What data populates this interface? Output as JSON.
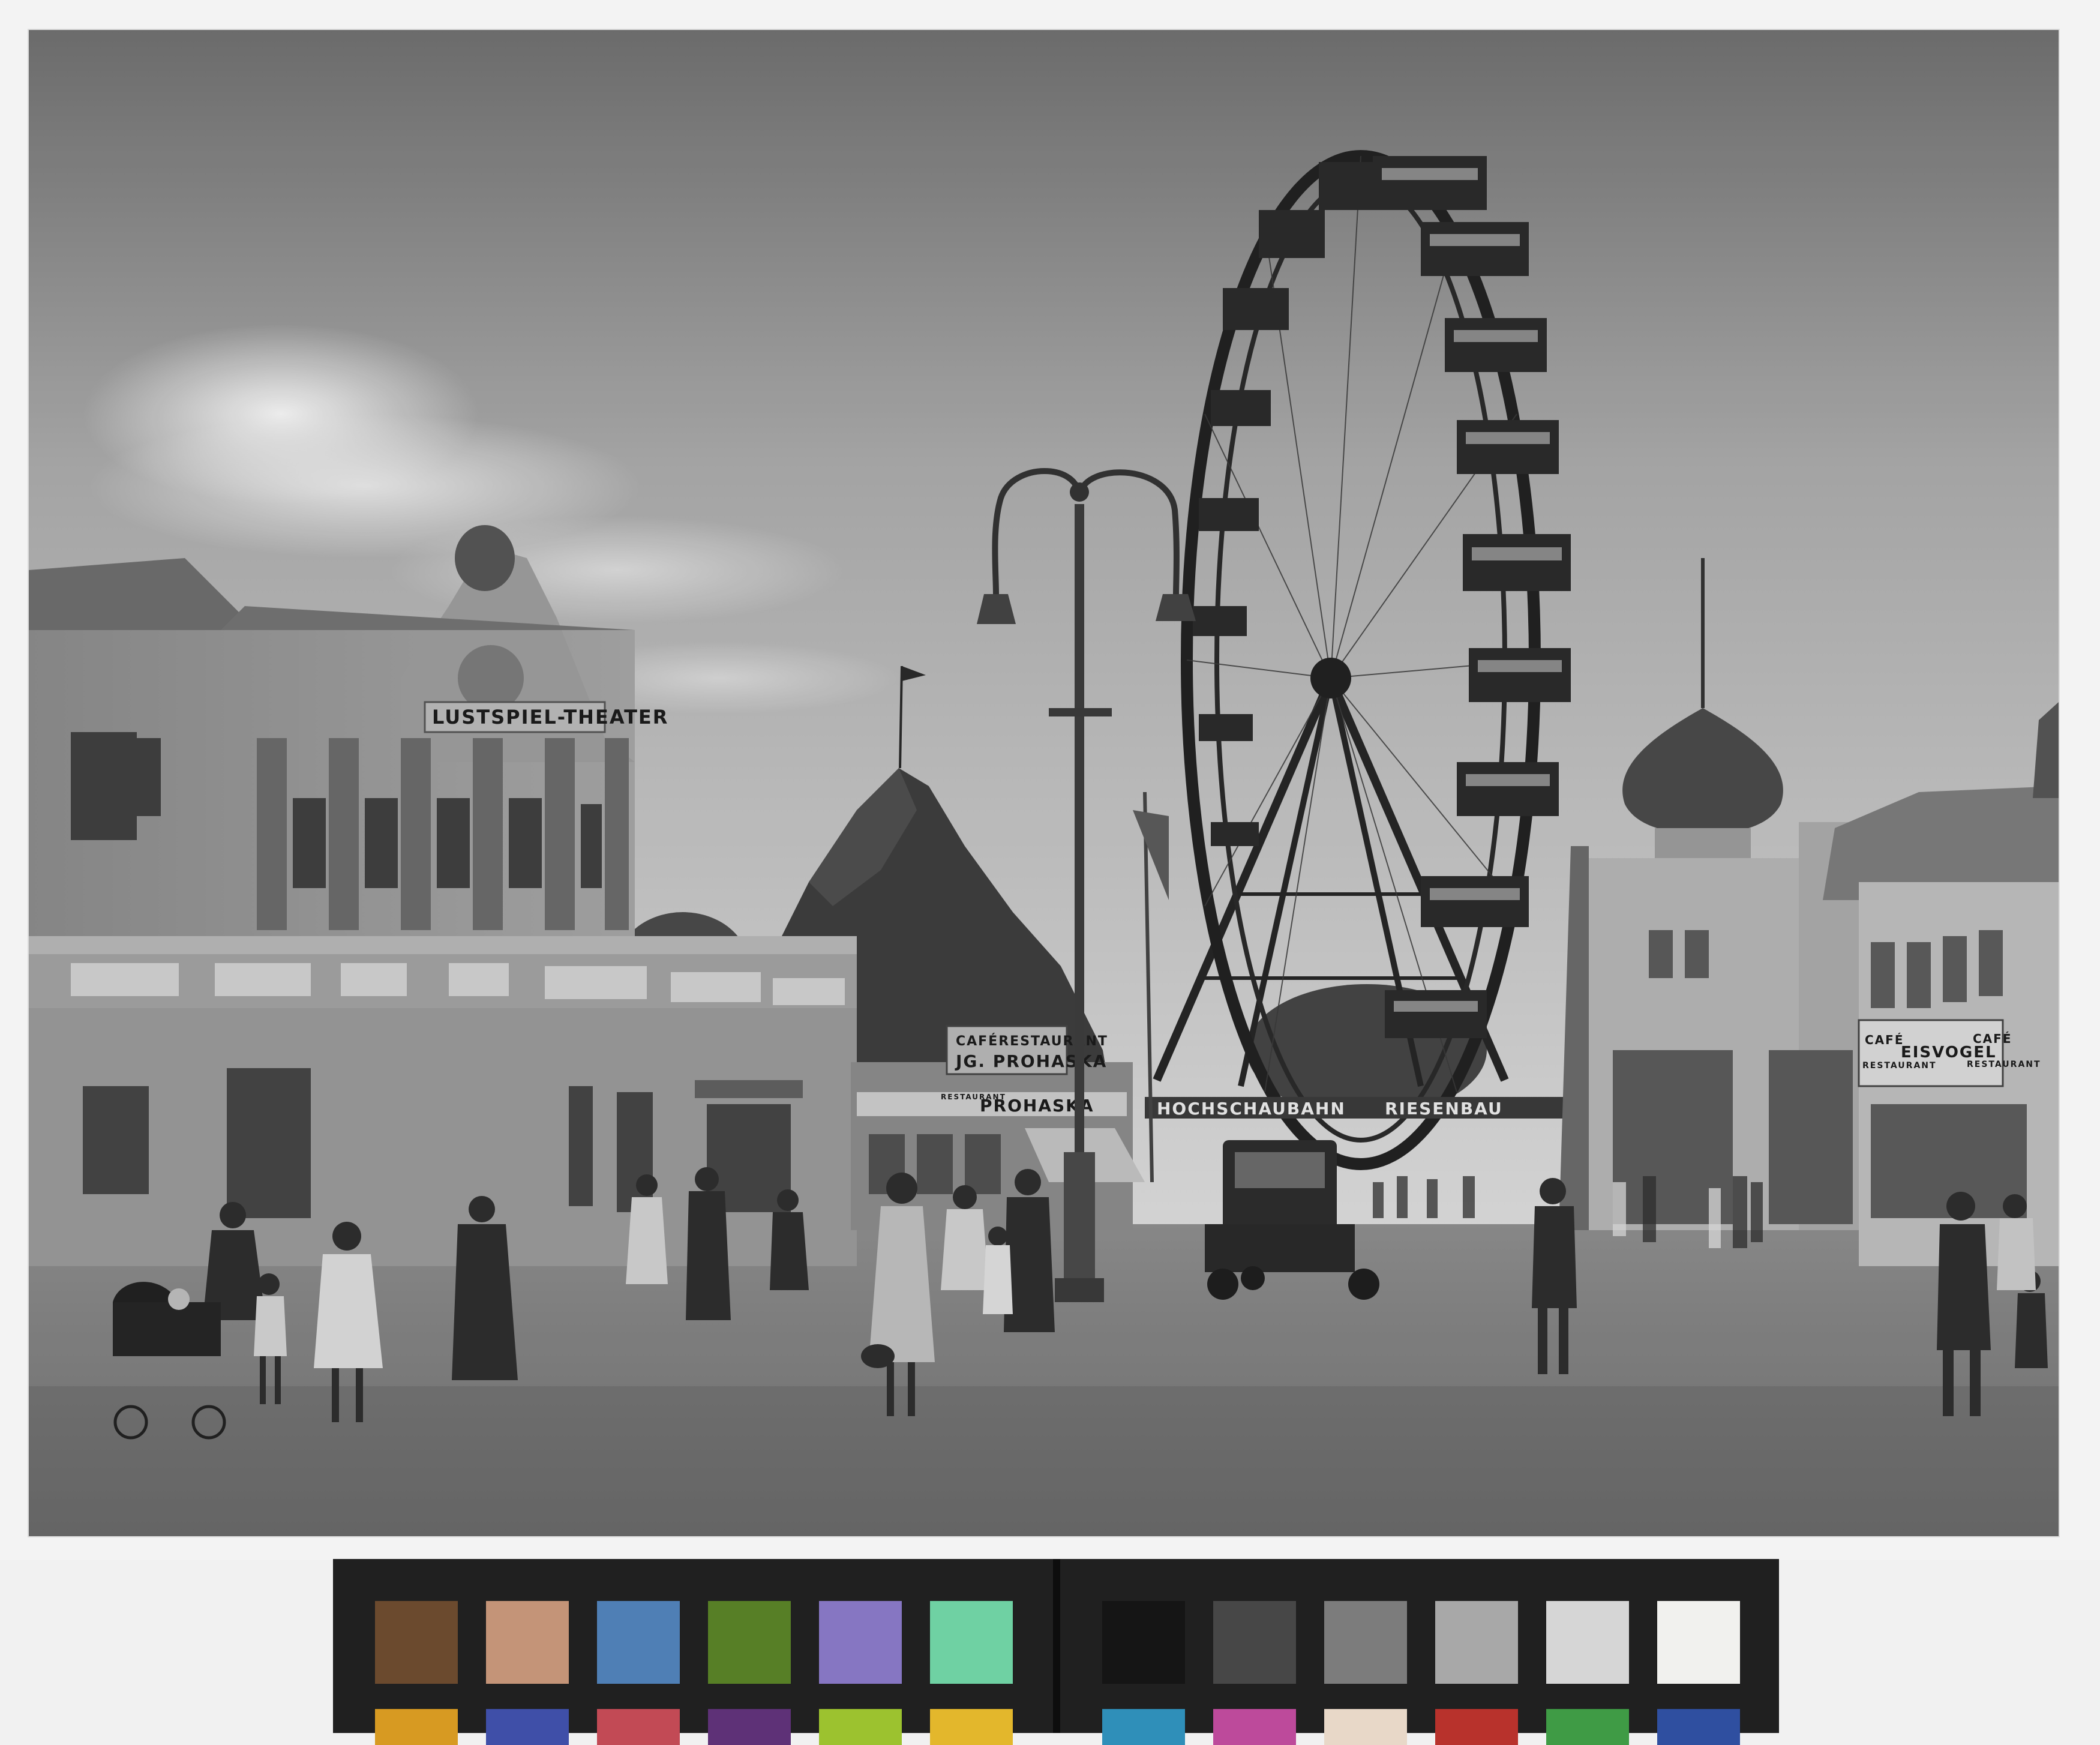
{
  "photo": {
    "signs": {
      "theater": "LUSTSPIEL-THEATER",
      "cafe_restaurant": "CAFÉRESTAURANT",
      "proprietor": "JG. PROHASKA",
      "restaurant_small": "RESTAURANT",
      "prohaska": "PROHASKA",
      "banner_left": "HOCHSCHAUBAHN",
      "banner_right": "RIESENBAU",
      "eisvogel": "EISVOGEL",
      "cafe_left": "CAFÉ",
      "restaurant_left": "RESTAURANT",
      "cafe_right": "CAFÉ",
      "restaurant_right": "RESTAURANT"
    }
  },
  "color_card": {
    "row1_left": [
      "#6b4a2e",
      "#c49478",
      "#4f7fb5",
      "#577f26",
      "#8676c2",
      "#6fd1a3"
    ],
    "row1_right": [
      "#151515",
      "#474747",
      "#7c7c7c",
      "#a8a8a8",
      "#d6d6d6",
      "#f1f1ee"
    ],
    "row2_left": [
      "#d79a22",
      "#3f4fa8",
      "#c24a55",
      "#5e3177",
      "#9cc22f",
      "#e3b72c"
    ],
    "row2_right": [
      "#2f8fb9",
      "#bd4a9b",
      "#e8d8c8",
      "#b8322c",
      "#3f9b45",
      "#2f4fa0"
    ]
  }
}
